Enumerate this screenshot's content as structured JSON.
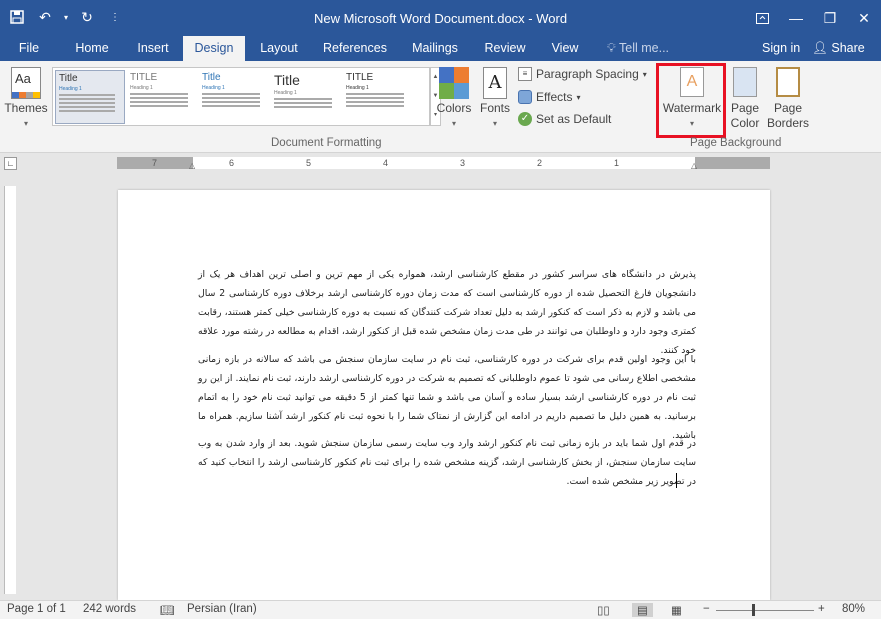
{
  "titlebar": {
    "title": "New Microsoft Word Document.docx - Word"
  },
  "tabs": [
    "File",
    "Home",
    "Insert",
    "Design",
    "Layout",
    "References",
    "Mailings",
    "Review",
    "View"
  ],
  "tellme": "Tell me...",
  "signin": "Sign in",
  "share": "Share",
  "ribbon": {
    "themes": "Themes",
    "styles": [
      {
        "title": "Title",
        "heading": "Heading 1"
      },
      {
        "title": "TITLE",
        "heading": "Heading 1"
      },
      {
        "title": "Title",
        "heading": "Heading 1"
      },
      {
        "title": "Title",
        "heading": "Heading 1"
      },
      {
        "title": "TITLE",
        "heading": "Heading 1"
      }
    ],
    "colors": "Colors",
    "fonts": "Fonts",
    "paragraph_spacing": "Paragraph Spacing",
    "effects": "Effects",
    "set_default": "Set as Default",
    "document_formatting": "Document Formatting",
    "watermark": "Watermark",
    "page_color": "Page Color",
    "page_borders": "Page Borders",
    "page_background": "Page Background"
  },
  "ruler": [
    "7",
    "6",
    "5",
    "4",
    "3",
    "2",
    "1"
  ],
  "document": {
    "paragraphs": [
      "پذیرش در دانشگاه های سراسر کشور در مقطع کارشناسی ارشد، همواره یکی از مهم ترین و اصلی ترین اهداف هر یک از دانشجویان فارغ التحصیل شده از دوره کارشناسی است که مدت زمان دوره کارشناسی ارشد برخلاف دوره کارشناسی 2 سال می باشد و لازم به ذکر است که کنکور ارشد به دلیل تعداد شرکت کنندگان که نسبت به دوره کارشناسی خیلی کمتر هستند، رقابت کمتری وجود دارد و داوطلبان می توانند در طی مدت زمان مشخص شده قبل از کنکور ارشد، اقدام به مطالعه در رشته مورد علاقه خود کنند.",
      "با این وجود اولین قدم برای شرکت در دوره کارشناسی، ثبت نام در سایت سازمان سنجش می باشد که سالانه در بازه زمانی مشخصی اطلاع رسانی می شود تا عموم داوطلبانی که تصمیم به شرکت در دوره کارشناسی ارشد دارند، ثبت نام نمایند. از این رو ثبت نام در دوره کارشناسی ارشد بسیار ساده و آسان می باشد و شما تنها کمتر از 5 دقیقه می توانید ثبت نام خود را به اتمام برسانید. به همین دلیل ما تصمیم داریم در ادامه این گزارش از نمتاک شما را با نحوه ثبت نام کنکور ارشد آشنا سازیم. همراه ما باشید.",
      "در قدم اول شما باید در بازه زمانی ثبت نام کنکور ارشد وارد وب سایت رسمی سازمان سنجش شوید. بعد از وارد شدن به وب سایت سازمان سنجش، از بخش کارشناسی ارشد، گزینه مشخص شده را برای ثبت نام کنکور کارشناسی ارشد را انتخاب کنید که در تصویر زیر مشخص شده است."
    ]
  },
  "status": {
    "page": "Page 1 of 1",
    "words": "242 words",
    "language": "Persian (Iran)",
    "zoom": "80%"
  },
  "colors": {
    "accent": "#2b579a",
    "highlight": "#e81123"
  }
}
